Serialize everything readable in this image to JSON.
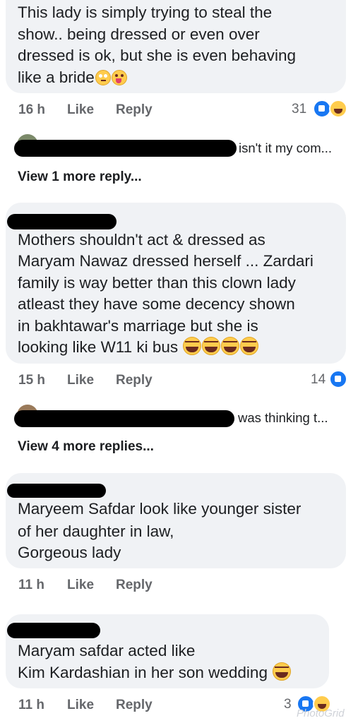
{
  "comments": [
    {
      "lines": [
        "This lady is simply trying to steal the",
        "show.. being dressed or even over",
        "dressed is ok, but she is even behaving",
        "like a bride"
      ],
      "emojis": [
        "face-with-rolling-eyes",
        "zany-face"
      ],
      "time": "16 h",
      "like_label": "Like",
      "reply_label": "Reply",
      "reaction_count": "31",
      "reactions": [
        "like",
        "haha"
      ]
    },
    {
      "lines": [
        "Mothers shouldn't act & dressed as",
        "Maryam Nawaz dressed herself ... Zardari",
        "family is way better than this clown lady",
        "atleast they have some decency  shown",
        "in bakhtawar's marriage but she is",
        "looking like W11 ki bus"
      ],
      "emojis": [
        "tears-of-joy",
        "tears-of-joy",
        "tears-of-joy",
        "tears-of-joy"
      ],
      "time": "15 h",
      "like_label": "Like",
      "reply_label": "Reply",
      "reaction_count": "14",
      "reactions": [
        "like"
      ]
    },
    {
      "lines": [
        "Maryeem Safdar look like younger sister",
        "of her daughter in law,",
        "Gorgeous lady"
      ],
      "time": "11 h",
      "like_label": "Like",
      "reply_label": "Reply"
    },
    {
      "lines": [
        "Maryam safdar acted  like",
        "Kim Kardashian in her son wedding"
      ],
      "emojis": [
        "tears-of-joy"
      ],
      "time": "11 h",
      "like_label": "Like",
      "reply_label": "Reply",
      "reaction_count": "3",
      "reactions": [
        "like",
        "haha"
      ]
    }
  ],
  "reply_previews": [
    {
      "text": "isn't it my com..."
    },
    {
      "text": "was thinking t..."
    }
  ],
  "more_replies": [
    "View 1 more reply...",
    "View 4 more replies..."
  ],
  "watermark": "PhotoGrid",
  "colors": {
    "bubble": "#f0f2f5",
    "meta": "#65676b",
    "text": "#1c1e21",
    "like_blue": "#1877f2",
    "haha_yellow": "#ffcc4d"
  }
}
